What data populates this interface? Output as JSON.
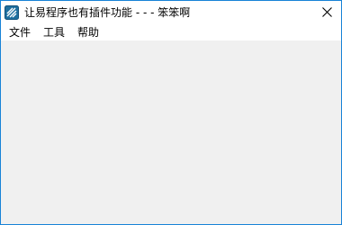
{
  "window": {
    "title": "让易程序也有插件功能 - - - 笨笨啊",
    "icon": "app-icon",
    "close_icon": "close-icon",
    "border_color": "#1883d7",
    "client_background": "#f0f0f0"
  },
  "menubar": {
    "items": [
      {
        "label": "文件"
      },
      {
        "label": "工具"
      },
      {
        "label": "帮助"
      }
    ]
  }
}
